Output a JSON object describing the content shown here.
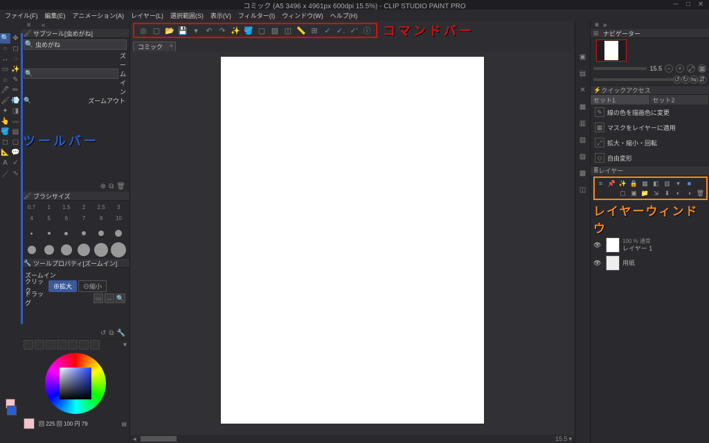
{
  "title": "コミック (A5 3496 x 4961px 600dpi 15.5%) - CLIP STUDIO PAINT PRO",
  "menu": {
    "file": "ファイル(F)",
    "edit": "編集(E)",
    "anim": "アニメーション(A)",
    "layer": "レイヤー(L)",
    "sel": "選択範囲(S)",
    "view": "表示(V)",
    "filter": "フィルター(I)",
    "window": "ウィンドウ(W)",
    "help": "ヘルプ(H)"
  },
  "subtool": {
    "header": "サブツール[虫めがね]",
    "searchvalue": "虫めがね",
    "zoomin": "ズームイン",
    "zoomout": "ズームアウト"
  },
  "brush": {
    "header": "ブラシサイズ",
    "labels": [
      "0.7",
      "1",
      "1.5",
      "2",
      "2.5",
      "3",
      "4",
      "5",
      "6",
      "7",
      "8",
      "10"
    ]
  },
  "toolprop": {
    "header": "ツールプロパティ[ズームイン]",
    "title": "ズームイン",
    "click": "クリック",
    "enlarge": "拡大",
    "shrink": "縮小",
    "drag": "ドラッグ"
  },
  "colorfoot": "回 225 回 100 円 79",
  "cmdbar_anno": "コマンドバー",
  "doctab": "コミック",
  "hscroll": "15.5",
  "navigator": "ナビゲーター",
  "navzoom": "15.5",
  "qa": {
    "header": "クイックアクセス",
    "set1": "セット1",
    "set2": "セット2"
  },
  "qa_items": {
    "a": "線の色を描画色に変更",
    "b": "マスクをレイヤーに適用",
    "c": "拡大・縮小・回転",
    "d": "自由変形"
  },
  "layerhdr": "レイヤー",
  "layers": {
    "l1name": "レイヤー 1",
    "l1op": "100 % 通常",
    "l2name": "用紙"
  },
  "layer_anno": "レイヤーウィンドウ",
  "toolbar_anno": "ツールバー"
}
